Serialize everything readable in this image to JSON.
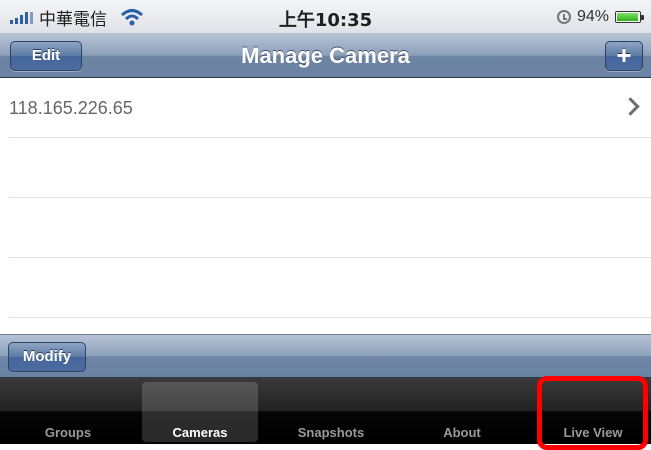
{
  "status_bar": {
    "carrier": "中華電信",
    "time": "上午10:35",
    "battery_percent": "94%",
    "battery_level": 0.94
  },
  "nav_bar": {
    "title": "Manage Camera",
    "left_button": "Edit",
    "right_button": "+"
  },
  "cameras": [
    {
      "address": "118.165.226.65"
    },
    {
      "address": ""
    },
    {
      "address": ""
    },
    {
      "address": ""
    }
  ],
  "toolbar": {
    "modify_label": "Modify"
  },
  "tabs": [
    {
      "label": "Groups",
      "selected": false
    },
    {
      "label": "Cameras",
      "selected": true
    },
    {
      "label": "Snapshots",
      "selected": false
    },
    {
      "label": "About",
      "selected": false
    },
    {
      "label": "Live View",
      "selected": false,
      "highlighted": true
    }
  ],
  "colors": {
    "nav_tint": "#6b83a2",
    "highlight": "#ff0000"
  }
}
